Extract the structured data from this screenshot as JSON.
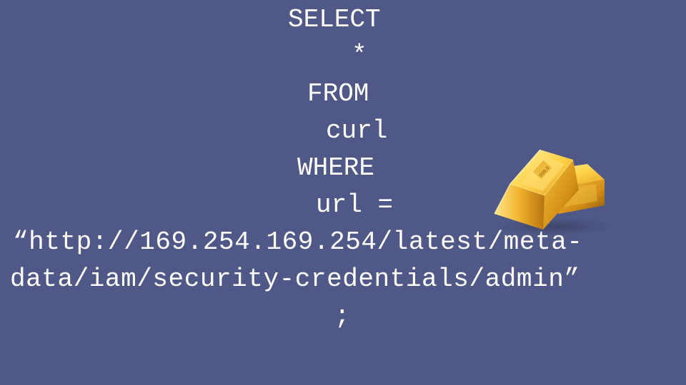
{
  "colors": {
    "background": "#4f5886",
    "text": "#ffffff",
    "gold_light": "#ffe37a",
    "gold_mid": "#e8b22a",
    "gold_dark": "#9a6510"
  },
  "query": {
    "select": "SELECT",
    "star": "*",
    "from": "FROM",
    "table": "curl",
    "where": "WHERE",
    "condition": "url =",
    "url_line1": "“http://169.254.169.254/latest/meta-",
    "url_line2": "data/iam/security-credentials/admin”",
    "terminator": ";"
  },
  "image": {
    "icon": "gold-bars-icon",
    "bar_stamp": "999.9"
  }
}
